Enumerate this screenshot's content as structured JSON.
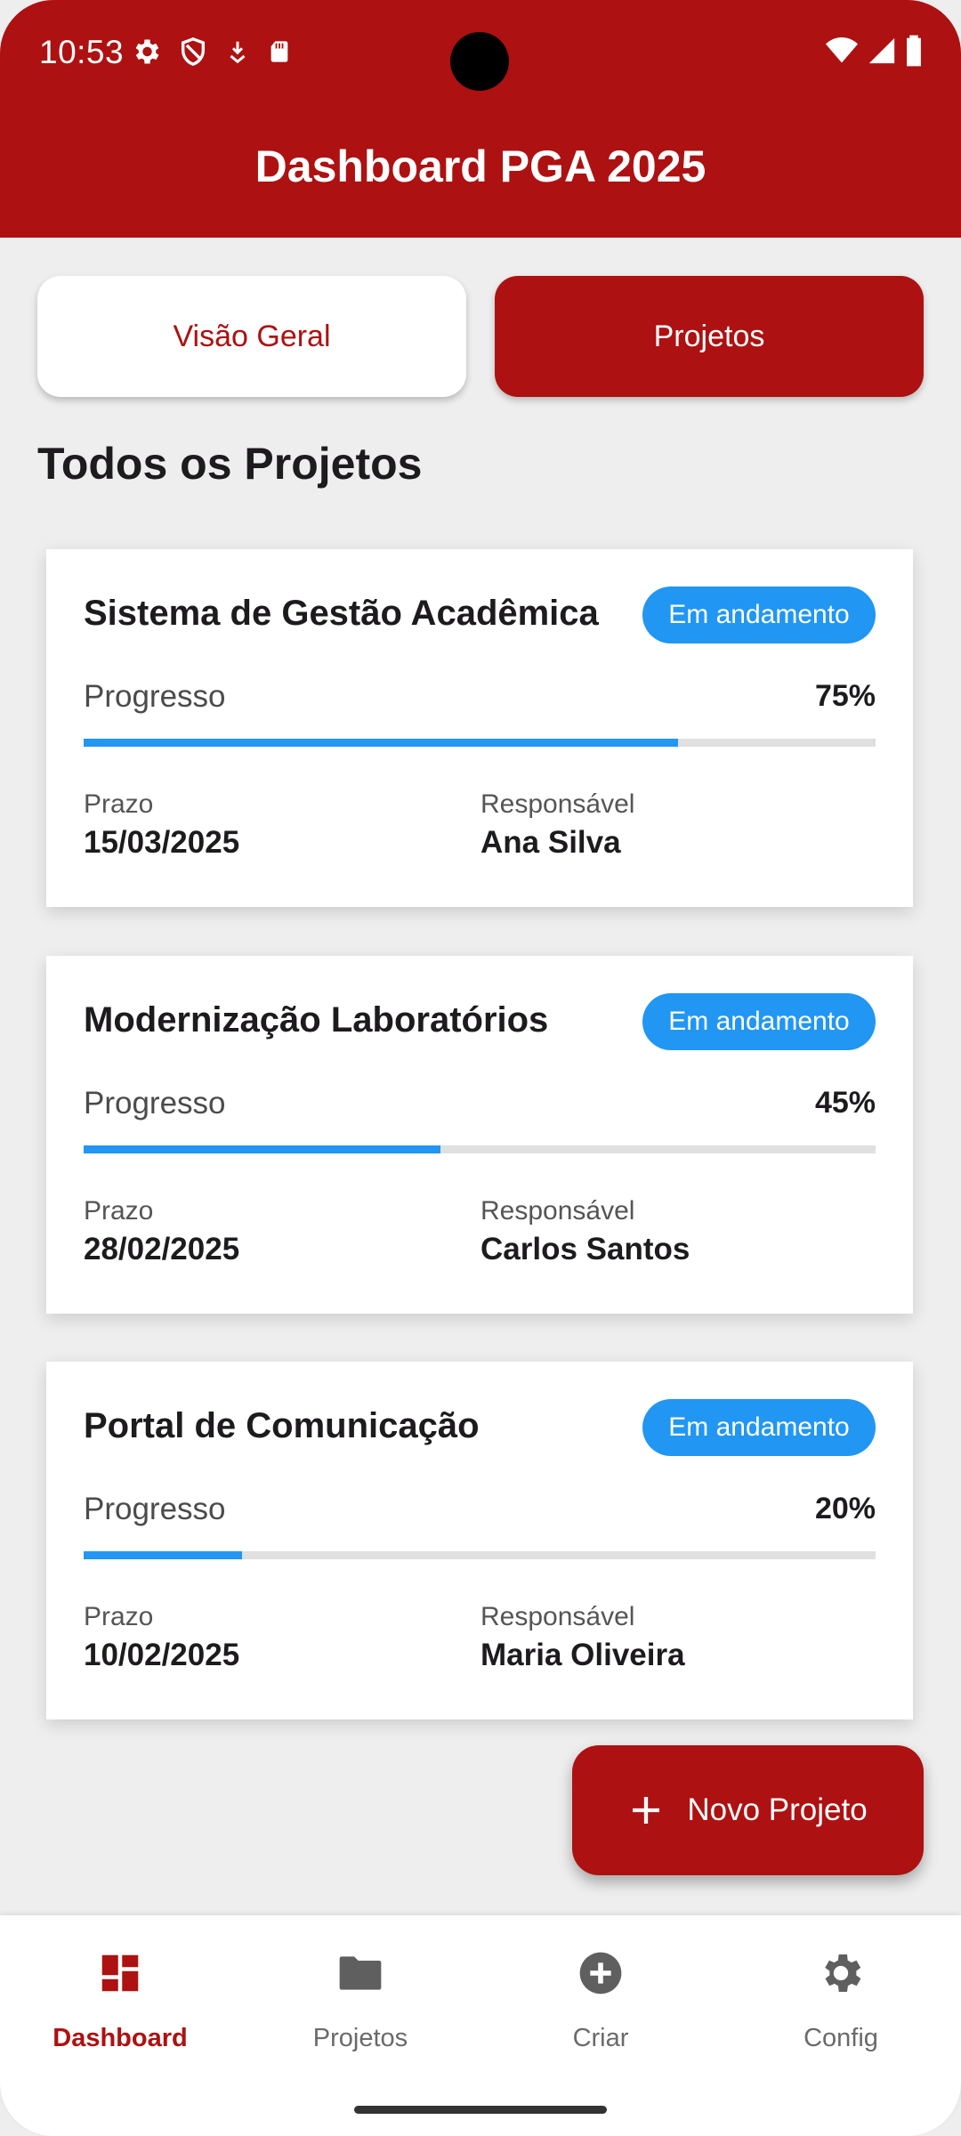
{
  "status_bar": {
    "time": "10:53"
  },
  "app_bar": {
    "title": "Dashboard PGA 2025"
  },
  "tabs": [
    {
      "label": "Visão Geral",
      "selected": false
    },
    {
      "label": "Projetos",
      "selected": true
    }
  ],
  "section_title": "Todos os Projetos",
  "progress_label": "Progresso",
  "deadline_label": "Prazo",
  "owner_label": "Responsável",
  "projects": [
    {
      "name": "Sistema de Gestão Acadêmica",
      "status": "Em andamento",
      "progress_text": "75%",
      "progress": 0.75,
      "deadline": "15/03/2025",
      "owner": "Ana Silva"
    },
    {
      "name": "Modernização Laboratórios",
      "status": "Em andamento",
      "progress_text": "45%",
      "progress": 0.45,
      "deadline": "28/02/2025",
      "owner": "Carlos Santos"
    },
    {
      "name": "Portal de Comunicação",
      "status": "Em andamento",
      "progress_text": "20%",
      "progress": 0.2,
      "deadline": "10/02/2025",
      "owner": "Maria Oliveira"
    }
  ],
  "fab": {
    "label": "Novo Projeto",
    "icon": "plus-icon"
  },
  "bottom_nav": [
    {
      "label": "Dashboard",
      "icon": "dashboard-icon",
      "active": true
    },
    {
      "label": "Projetos",
      "icon": "folder-icon",
      "active": false
    },
    {
      "label": "Criar",
      "icon": "add-circle-icon",
      "active": false
    },
    {
      "label": "Config",
      "icon": "gear-icon",
      "active": false
    }
  ],
  "colors": {
    "primary": "#ad1111",
    "accent": "#2196f3",
    "background": "#eeeeee"
  }
}
